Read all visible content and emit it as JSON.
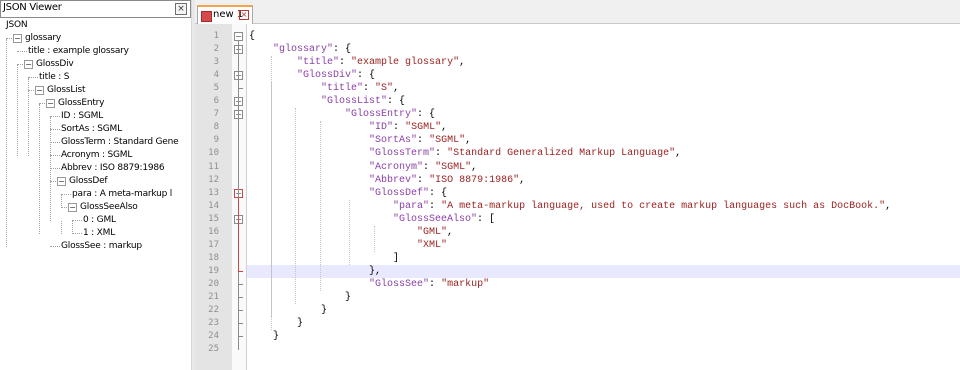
{
  "viewer": {
    "title": "JSON Viewer",
    "close_glyph": "×",
    "tree": [
      {
        "label": "JSON",
        "expander": ""
      },
      {
        "label": "glossary",
        "expander": "−"
      },
      {
        "label": "title : example glossary",
        "expander": ""
      },
      {
        "label": "GlossDiv",
        "expander": "−"
      },
      {
        "label": "title : S",
        "expander": ""
      },
      {
        "label": "GlossList",
        "expander": "−"
      },
      {
        "label": "GlossEntry",
        "expander": "−"
      },
      {
        "label": "ID : SGML",
        "expander": ""
      },
      {
        "label": "SortAs : SGML",
        "expander": ""
      },
      {
        "label": "GlossTerm : Standard Gene",
        "expander": ""
      },
      {
        "label": "Acronym : SGML",
        "expander": ""
      },
      {
        "label": "Abbrev : ISO 8879:1986",
        "expander": ""
      },
      {
        "label": "GlossDef",
        "expander": "−"
      },
      {
        "label": "para : A meta-markup l",
        "expander": ""
      },
      {
        "label": "GlossSeeAlso",
        "expander": "−"
      },
      {
        "label": "0 : GML",
        "expander": ""
      },
      {
        "label": "1 : XML",
        "expander": ""
      },
      {
        "label": "GlossSee : markup",
        "expander": ""
      }
    ]
  },
  "editor": {
    "tab_label": "new 1",
    "tab_close_glyph": "×",
    "tab_unsaved_color": "#d54b4b",
    "highlighted_line": 19,
    "code_lines": [
      [
        {
          "t": "{",
          "c": "p"
        }
      ],
      [
        {
          "t": "    ",
          "c": "p"
        },
        {
          "t": "\"glossary\"",
          "c": "k"
        },
        {
          "t": ": {",
          "c": "p"
        }
      ],
      [
        {
          "t": "        ",
          "c": "p"
        },
        {
          "t": "\"title\"",
          "c": "k"
        },
        {
          "t": ": ",
          "c": "p"
        },
        {
          "t": "\"example glossary\"",
          "c": "s"
        },
        {
          "t": ",",
          "c": "p"
        }
      ],
      [
        {
          "t": "        ",
          "c": "p"
        },
        {
          "t": "\"GlossDiv\"",
          "c": "k"
        },
        {
          "t": ": {",
          "c": "p"
        }
      ],
      [
        {
          "t": "            ",
          "c": "p"
        },
        {
          "t": "\"title\"",
          "c": "k"
        },
        {
          "t": ": ",
          "c": "p"
        },
        {
          "t": "\"S\"",
          "c": "s"
        },
        {
          "t": ",",
          "c": "p"
        }
      ],
      [
        {
          "t": "            ",
          "c": "p"
        },
        {
          "t": "\"GlossList\"",
          "c": "k"
        },
        {
          "t": ": {",
          "c": "p"
        }
      ],
      [
        {
          "t": "                ",
          "c": "p"
        },
        {
          "t": "\"GlossEntry\"",
          "c": "k"
        },
        {
          "t": ": {",
          "c": "p"
        }
      ],
      [
        {
          "t": "                    ",
          "c": "p"
        },
        {
          "t": "\"ID\"",
          "c": "k"
        },
        {
          "t": ": ",
          "c": "p"
        },
        {
          "t": "\"SGML\"",
          "c": "s"
        },
        {
          "t": ",",
          "c": "p"
        }
      ],
      [
        {
          "t": "                    ",
          "c": "p"
        },
        {
          "t": "\"SortAs\"",
          "c": "k"
        },
        {
          "t": ": ",
          "c": "p"
        },
        {
          "t": "\"SGML\"",
          "c": "s"
        },
        {
          "t": ",",
          "c": "p"
        }
      ],
      [
        {
          "t": "                    ",
          "c": "p"
        },
        {
          "t": "\"GlossTerm\"",
          "c": "k"
        },
        {
          "t": ": ",
          "c": "p"
        },
        {
          "t": "\"Standard Generalized Markup Language\"",
          "c": "s"
        },
        {
          "t": ",",
          "c": "p"
        }
      ],
      [
        {
          "t": "                    ",
          "c": "p"
        },
        {
          "t": "\"Acronym\"",
          "c": "k"
        },
        {
          "t": ": ",
          "c": "p"
        },
        {
          "t": "\"SGML\"",
          "c": "s"
        },
        {
          "t": ",",
          "c": "p"
        }
      ],
      [
        {
          "t": "                    ",
          "c": "p"
        },
        {
          "t": "\"Abbrev\"",
          "c": "k"
        },
        {
          "t": ": ",
          "c": "p"
        },
        {
          "t": "\"ISO 8879:1986\"",
          "c": "s"
        },
        {
          "t": ",",
          "c": "p"
        }
      ],
      [
        {
          "t": "                    ",
          "c": "p"
        },
        {
          "t": "\"GlossDef\"",
          "c": "k"
        },
        {
          "t": ": {",
          "c": "p"
        }
      ],
      [
        {
          "t": "                        ",
          "c": "p"
        },
        {
          "t": "\"para\"",
          "c": "k"
        },
        {
          "t": ": ",
          "c": "p"
        },
        {
          "t": "\"A meta-markup language, used to create markup languages such as DocBook.\"",
          "c": "s"
        },
        {
          "t": ",",
          "c": "p"
        }
      ],
      [
        {
          "t": "                        ",
          "c": "p"
        },
        {
          "t": "\"GlossSeeAlso\"",
          "c": "k"
        },
        {
          "t": ": [",
          "c": "p"
        }
      ],
      [
        {
          "t": "                            ",
          "c": "p"
        },
        {
          "t": "\"GML\"",
          "c": "s"
        },
        {
          "t": ",",
          "c": "p"
        }
      ],
      [
        {
          "t": "                            ",
          "c": "p"
        },
        {
          "t": "\"XML\"",
          "c": "s"
        }
      ],
      [
        {
          "t": "                        ]",
          "c": "p"
        }
      ],
      [
        {
          "t": "                    },",
          "c": "p"
        }
      ],
      [
        {
          "t": "                    ",
          "c": "p"
        },
        {
          "t": "\"GlossSee\"",
          "c": "k"
        },
        {
          "t": ": ",
          "c": "p"
        },
        {
          "t": "\"markup\"",
          "c": "s"
        }
      ],
      [
        {
          "t": "                }",
          "c": "p"
        }
      ],
      [
        {
          "t": "            }",
          "c": "p"
        }
      ],
      [
        {
          "t": "        }",
          "c": "p"
        }
      ],
      [
        {
          "t": "    }",
          "c": "p"
        }
      ],
      [
        {
          "t": "",
          "c": "p"
        }
      ]
    ]
  },
  "colors": {
    "key": "#8b3fa8",
    "string": "#9c2222",
    "line_highlight": "#e8e8ff",
    "fold_active": "#d34545"
  }
}
